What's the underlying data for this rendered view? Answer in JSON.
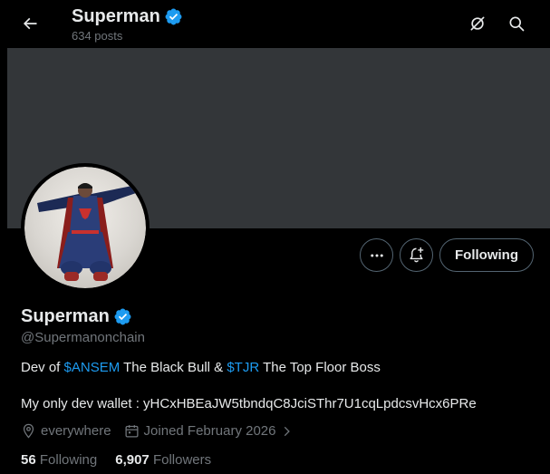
{
  "header": {
    "name": "Superman",
    "posts_count": "634 posts",
    "back_icon": "arrow-left-icon",
    "grok_icon": "grok-icon",
    "search_icon": "search-icon"
  },
  "profile": {
    "name": "Superman",
    "handle": "@Supermanonchain",
    "verified_color": "#1d9bf0",
    "bio": {
      "line1_prefix": "Dev of ",
      "link1": "$ANSEM",
      "line1_middle": " The Black Bull & ",
      "link2": "$TJR",
      "line1_suffix": " The Top Floor Boss",
      "line2": "My only dev wallet : yHCxHBEaJW5tbndqC8JciSThr7U1cqLpdcsvHcx6PRe"
    },
    "location": "everywhere",
    "joined": "Joined February 2026",
    "following_count": "56",
    "following_label": "Following",
    "followers_count": "6,907",
    "followers_label": "Followers"
  },
  "actions": {
    "more_icon": "more-icon",
    "notify_icon": "bell-plus-icon",
    "following_button": "Following"
  },
  "colors": {
    "background": "#000000",
    "banner": "#333639",
    "accent": "#1d9bf0",
    "muted_text": "#71767b",
    "primary_text": "#e7e9ea"
  }
}
